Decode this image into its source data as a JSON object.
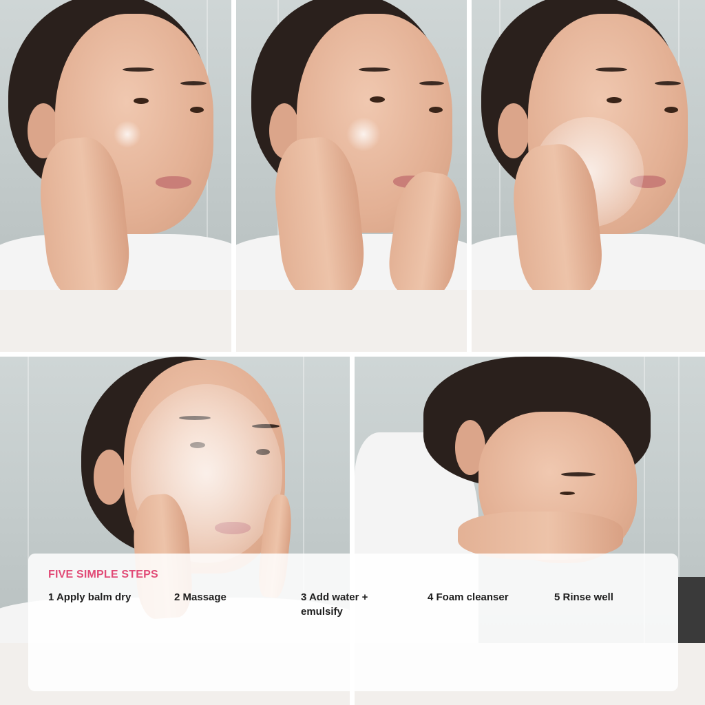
{
  "overlay": {
    "title": "FIVE SIMPLE STEPS",
    "accent_color": "#e14a76",
    "steps": [
      {
        "label": "1 Apply balm dry"
      },
      {
        "label": "2 Massage"
      },
      {
        "label": "3 Add water + emulsify"
      },
      {
        "label": "4 Foam cleanser"
      },
      {
        "label": "5 Rinse well"
      }
    ]
  }
}
